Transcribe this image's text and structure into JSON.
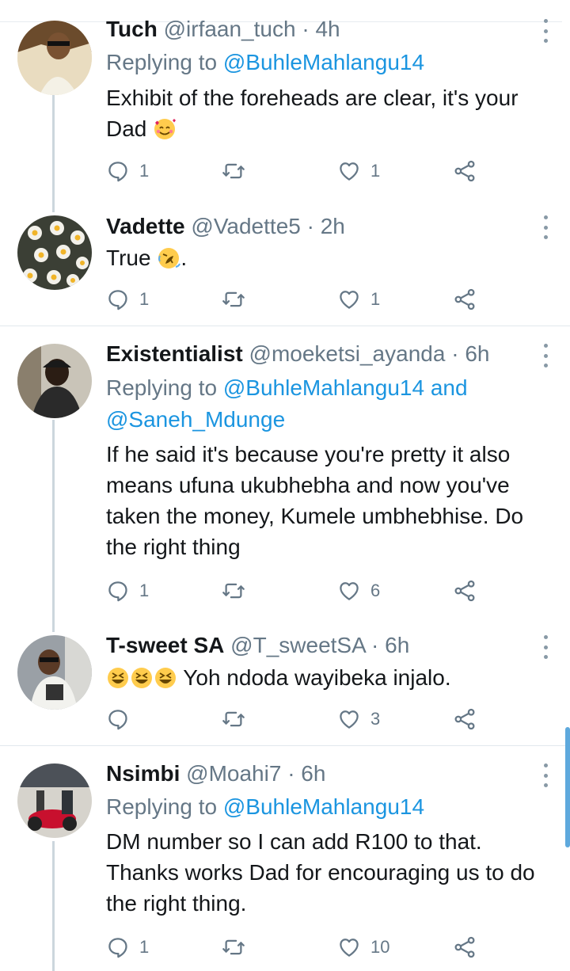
{
  "colors": {
    "link": "#1b95e0",
    "muted": "#657786",
    "text": "#14171a",
    "divider": "#e1e8ed",
    "thread": "#ccd6dd",
    "scrollbar": "#5ea9dd"
  },
  "icons": {
    "reply": "reply-icon",
    "retweet": "retweet-icon",
    "like": "heart-icon",
    "share": "share-icon",
    "more": "more-options-icon"
  },
  "tweets": [
    {
      "name": "Tuch",
      "handle": "@irfaan_tuch",
      "sep": "·",
      "time": "4h",
      "replying_prefix": "Replying to",
      "replying_to": "@BuhleMahlangu14",
      "text": "Exhibit of the foreheads are clear, it's your Dad",
      "emoji": "smiling-face-with-hearts",
      "replies": "1",
      "retweets": "",
      "likes": "1"
    },
    {
      "name": "Vadette",
      "handle": "@Vadette5",
      "sep": "·",
      "time": "2h",
      "text": "True",
      "text_after": ".",
      "emoji": "rolling-on-floor-laughing",
      "replies": "1",
      "retweets": "",
      "likes": "1"
    },
    {
      "name": "Existentialist",
      "handle": "@moeketsi_ayanda",
      "sep": "·",
      "time": "6h",
      "replying_prefix": "Replying to",
      "replying_to": "@BuhleMahlangu14",
      "replying_and": "and",
      "replying_to_2": "@Saneh_Mdunge",
      "text": "If he said it's because you're pretty it also means ufuna ukubhebha and now you've taken the money, Kumele umbhebhise. Do the right thing",
      "replies": "1",
      "retweets": "",
      "likes": "6"
    },
    {
      "name": "T-sweet SA",
      "handle": "@T_sweetSA",
      "sep": "·",
      "time": "6h",
      "text": "Yoh ndoda wayibeka injalo.",
      "emoji": "grinning-squinting-face",
      "replies": "",
      "retweets": "",
      "likes": "3"
    },
    {
      "name": "Nsimbi",
      "handle": "@Moahi7",
      "sep": "·",
      "time": "6h",
      "replying_prefix": "Replying to",
      "replying_to": "@BuhleMahlangu14",
      "text": "DM number so I can add R100 to that. Thanks works Dad for encouraging us to do the right thing.",
      "replies": "1",
      "retweets": "",
      "likes": "10"
    }
  ]
}
